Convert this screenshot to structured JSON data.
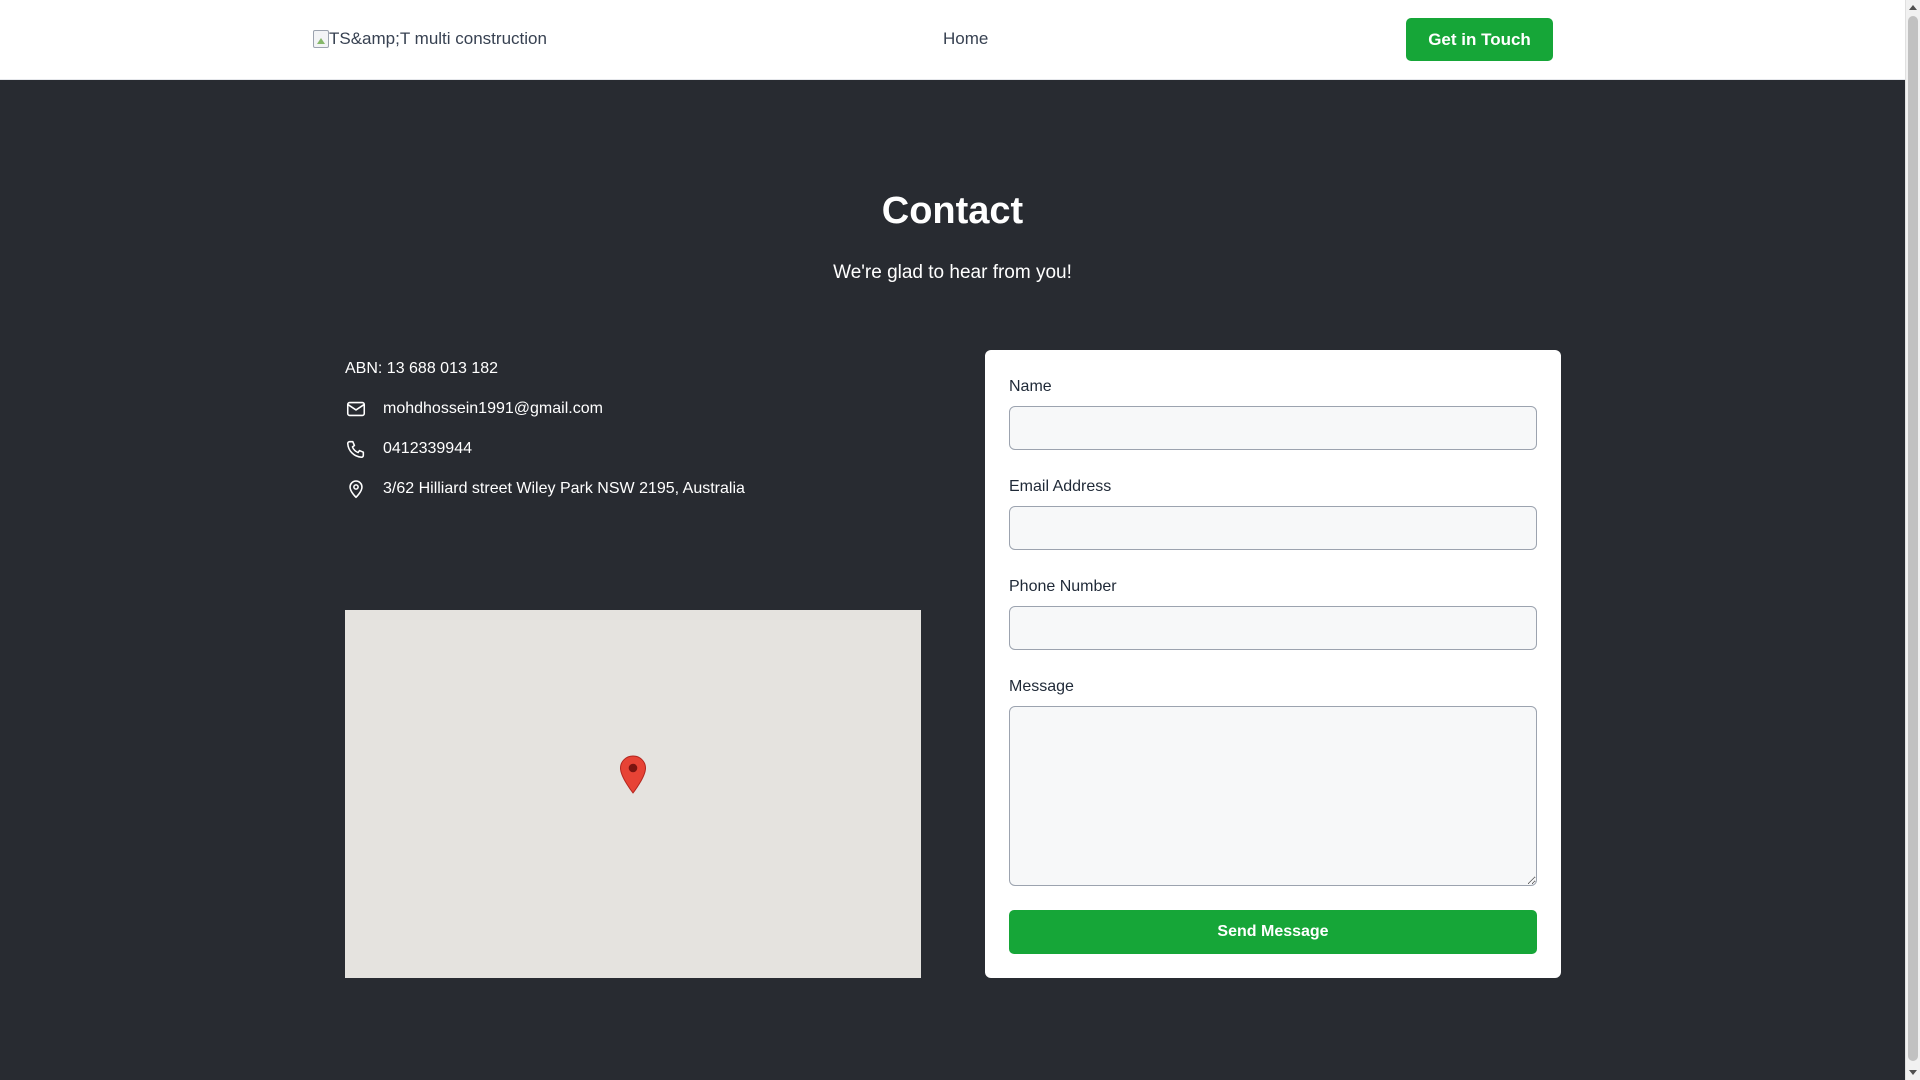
{
  "header": {
    "logo_alt": "TS&amp;T multi construction",
    "nav_home": "Home",
    "cta_label": "Get in Touch"
  },
  "hero": {
    "title": "Contact",
    "subtitle": "We're glad to hear from you!"
  },
  "contact": {
    "abn": "ABN: 13 688 013 182",
    "email": "mohdhossein1991@gmail.com",
    "phone": "0412339944",
    "address": "3/62 Hilliard street Wiley Park NSW 2195, Australia"
  },
  "form": {
    "name_label": "Name",
    "email_label": "Email Address",
    "phone_label": "Phone Number",
    "message_label": "Message",
    "submit_label": "Send Message"
  },
  "colors": {
    "accent": "#16a638",
    "background": "#282b31",
    "map_bg": "#e5e3df",
    "pin": "#e74335"
  },
  "icons": {
    "email": "mail-icon",
    "phone": "phone-icon",
    "address": "map-pin-icon",
    "map_marker": "map-marker-icon"
  }
}
